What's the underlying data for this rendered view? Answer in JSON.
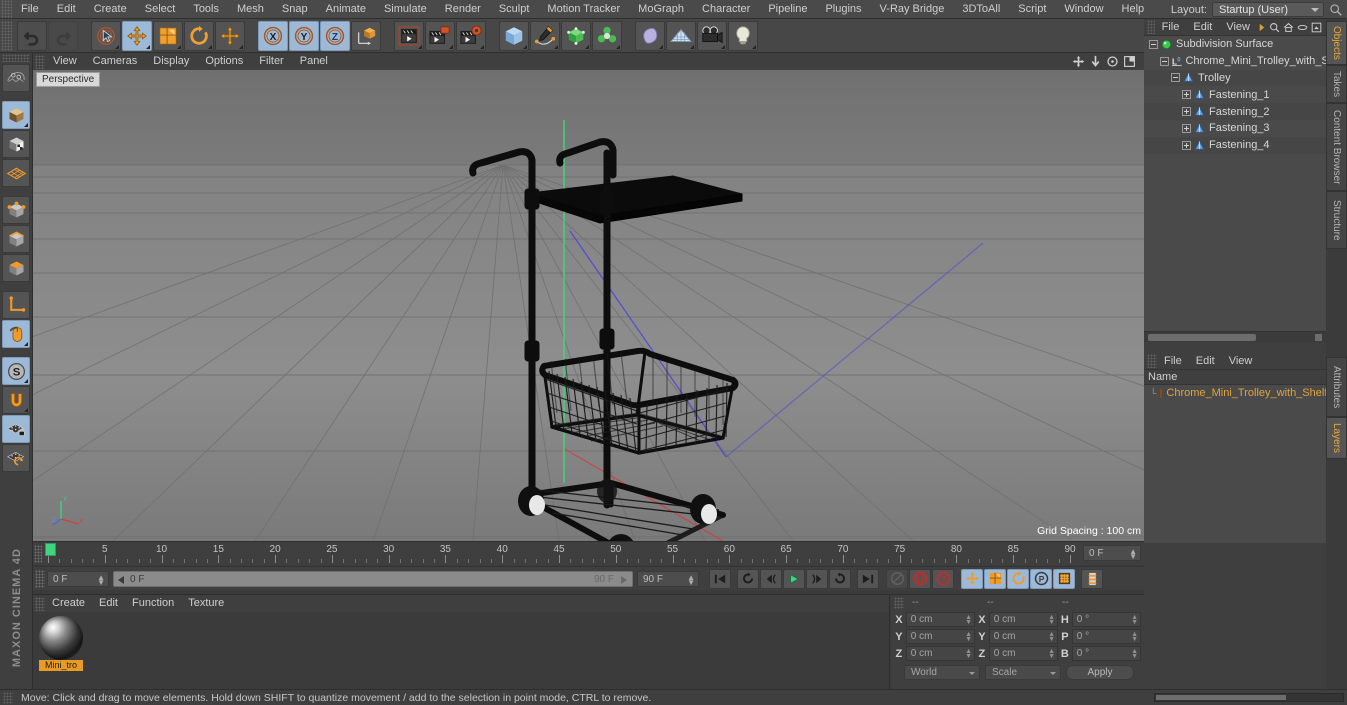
{
  "app": {
    "title": "Cinema 4D",
    "brand": "MAXON CINEMA 4D"
  },
  "menubar": {
    "items": [
      {
        "label": "File"
      },
      {
        "label": "Edit"
      },
      {
        "label": "Create"
      },
      {
        "label": "Select"
      },
      {
        "label": "Tools"
      },
      {
        "label": "Mesh"
      },
      {
        "label": "Snap"
      },
      {
        "label": "Animate"
      },
      {
        "label": "Simulate"
      },
      {
        "label": "Render"
      },
      {
        "label": "Sculpt"
      },
      {
        "label": "Motion Tracker"
      },
      {
        "label": "MoGraph"
      },
      {
        "label": "Character"
      },
      {
        "label": "Pipeline"
      },
      {
        "label": "Plugins"
      },
      {
        "label": "V-Ray Bridge"
      },
      {
        "label": "3DToAll"
      },
      {
        "label": "Script"
      },
      {
        "label": "Window"
      },
      {
        "label": "Help"
      }
    ],
    "layout_label": "Layout:",
    "layout_value": "Startup (User)",
    "search_icon": "search-icon"
  },
  "toolbar": {
    "buttons": [
      {
        "name": "undo-button",
        "icon": "undo-arrow-icon",
        "state": "enabled"
      },
      {
        "name": "redo-button",
        "icon": "redo-arrow-icon",
        "state": "disabled"
      },
      {
        "name": "live-selection-tool",
        "icon": "cursor-circle-icon",
        "state": "normal"
      },
      {
        "name": "move-tool",
        "icon": "move-arrows-icon",
        "state": "active"
      },
      {
        "name": "scale-tool",
        "icon": "scale-box-icon",
        "state": "normal"
      },
      {
        "name": "rotate-tool",
        "icon": "rotate-ring-icon",
        "state": "normal"
      },
      {
        "name": "move-axis-tool",
        "icon": "plus-arrows-icon",
        "state": "normal"
      },
      {
        "name": "x-axis-lock",
        "icon": "x-axis-icon",
        "state": "active"
      },
      {
        "name": "y-axis-lock",
        "icon": "y-axis-icon",
        "state": "active"
      },
      {
        "name": "z-axis-lock",
        "icon": "z-axis-icon",
        "state": "active"
      },
      {
        "name": "world-object-coordinates",
        "icon": "world-axis-cube-icon",
        "state": "normal"
      },
      {
        "name": "render-view",
        "icon": "render-clapper-icon",
        "state": "normal"
      },
      {
        "name": "render-region",
        "icon": "render-region-icon",
        "state": "normal"
      },
      {
        "name": "render-settings",
        "icon": "render-settings-icon",
        "state": "normal"
      },
      {
        "name": "add-cube-object",
        "icon": "cube-icon",
        "state": "normal"
      },
      {
        "name": "spline-pen",
        "icon": "pen-spline-icon",
        "state": "normal"
      },
      {
        "name": "generators",
        "icon": "green-cube-icon",
        "state": "normal"
      },
      {
        "name": "deformers",
        "icon": "green-atom-icon",
        "state": "normal"
      },
      {
        "name": "scene-environment",
        "icon": "environment-blob-icon",
        "state": "normal"
      },
      {
        "name": "scene-floor",
        "icon": "floor-grid-icon",
        "state": "normal"
      },
      {
        "name": "camera-object",
        "icon": "camera-icon",
        "state": "normal"
      },
      {
        "name": "light-object",
        "icon": "lightbulb-icon",
        "state": "normal"
      }
    ]
  },
  "left_toolbar": {
    "buttons": [
      {
        "name": "make-editable",
        "icon": "make-editable-icon",
        "state": "normal"
      },
      {
        "name": "model-mode",
        "icon": "model-cube-icon",
        "state": "active"
      },
      {
        "name": "texture-mode",
        "icon": "texture-cube-icon",
        "state": "normal"
      },
      {
        "name": "workplane-mode",
        "icon": "workplane-grid-icon",
        "state": "normal"
      },
      {
        "name": "point-mode",
        "icon": "point-cube-icon",
        "state": "normal"
      },
      {
        "name": "edge-mode",
        "icon": "edge-cube-icon",
        "state": "normal"
      },
      {
        "name": "polygon-mode",
        "icon": "polygon-cube-icon",
        "state": "normal"
      },
      {
        "name": "enable-axis-modification",
        "icon": "axis-l-icon",
        "state": "normal"
      },
      {
        "name": "viewport-solo",
        "icon": "mouse-icon",
        "state": "active"
      },
      {
        "name": "soft-selection",
        "icon": "s-circle-icon",
        "state": "active"
      },
      {
        "name": "snap-enable",
        "icon": "magnet-icon",
        "state": "normal"
      },
      {
        "name": "workplane-lock",
        "icon": "grid-lock-icon",
        "state": "active"
      },
      {
        "name": "workplane-reset",
        "icon": "grid-reset-icon",
        "state": "normal"
      }
    ]
  },
  "viewport": {
    "menu": [
      {
        "label": "View"
      },
      {
        "label": "Cameras"
      },
      {
        "label": "Display"
      },
      {
        "label": "Options"
      },
      {
        "label": "Filter"
      },
      {
        "label": "Panel"
      }
    ],
    "view_name": "Perspective",
    "grid_spacing": "Grid Spacing : 100 cm",
    "icons": [
      {
        "name": "pan-view-icon"
      },
      {
        "name": "dolly-view-icon"
      },
      {
        "name": "rotate-view-icon"
      },
      {
        "name": "maximize-view-icon"
      }
    ],
    "axis_labels": {
      "y": "Y",
      "x": "X",
      "z": "Z"
    },
    "scene_object": "Chrome Mini Trolley with Shelf"
  },
  "object_manager": {
    "menu": [
      {
        "label": "File"
      },
      {
        "label": "Edit"
      },
      {
        "label": "View"
      }
    ],
    "head_icons": [
      "chevron-right-icon",
      "search-icon",
      "home-icon",
      "ellipse-icon",
      "fit-icon"
    ],
    "tree": [
      {
        "label": "Subdivision Surface",
        "depth": 0,
        "icon": "subdivision-surface-icon",
        "expander": "minus",
        "alt": false
      },
      {
        "label": "Chrome_Mini_Trolley_with_Shelf",
        "depth": 1,
        "icon": "layer-icon",
        "expander": "minus",
        "alt": false
      },
      {
        "label": "Trolley",
        "depth": 2,
        "icon": "null-object-icon",
        "expander": "minus",
        "alt": true
      },
      {
        "label": "Fastening_1",
        "depth": 3,
        "icon": "null-object-icon",
        "expander": "plus",
        "alt": false
      },
      {
        "label": "Fastening_2",
        "depth": 3,
        "icon": "null-object-icon",
        "expander": "plus",
        "alt": true
      },
      {
        "label": "Fastening_3",
        "depth": 3,
        "icon": "null-object-icon",
        "expander": "plus",
        "alt": false
      },
      {
        "label": "Fastening_4",
        "depth": 3,
        "icon": "null-object-icon",
        "expander": "plus",
        "alt": true
      }
    ]
  },
  "layer_manager": {
    "menu": [
      {
        "label": "File"
      },
      {
        "label": "Edit"
      },
      {
        "label": "View"
      }
    ],
    "column_header": "Name",
    "rows": [
      {
        "label": "Chrome_Mini_Trolley_with_Shelf_",
        "color": "#e07b2a"
      }
    ]
  },
  "panel_tabs_top": [
    {
      "label": "Objects",
      "selected": true
    },
    {
      "label": "Takes",
      "selected": false
    },
    {
      "label": "Content Browser",
      "selected": false
    },
    {
      "label": "Structure",
      "selected": false
    }
  ],
  "panel_tabs_bottom": [
    {
      "label": "Attributes",
      "selected": false
    },
    {
      "label": "Layers",
      "selected": true
    }
  ],
  "timeline": {
    "ticks": [
      0,
      5,
      10,
      15,
      20,
      25,
      30,
      35,
      40,
      45,
      50,
      55,
      60,
      65,
      70,
      75,
      80,
      85,
      90
    ],
    "min": 0,
    "max": 90,
    "current_frame_label": "0 F",
    "playhead_frame": 0
  },
  "transport": {
    "current_frame_field": "0 F",
    "range_start_label": "0 F",
    "range_end_label": "90 F",
    "end_frame_field": "90 F",
    "buttons": [
      {
        "name": "go-to-start-button",
        "icon": "skip-start-icon",
        "state": "normal"
      },
      {
        "name": "play-backwards-button",
        "icon": "loop-back-icon",
        "state": "normal"
      },
      {
        "name": "previous-frame-button",
        "icon": "step-back-icon",
        "state": "normal"
      },
      {
        "name": "play-button",
        "icon": "play-icon",
        "state": "normal"
      },
      {
        "name": "next-frame-button",
        "icon": "step-forward-icon",
        "state": "normal"
      },
      {
        "name": "play-forward-loop-button",
        "icon": "loop-forward-icon",
        "state": "normal"
      },
      {
        "name": "go-to-end-button",
        "icon": "skip-end-icon",
        "state": "normal"
      },
      {
        "name": "record-active-objects-button",
        "icon": "record-disabled-icon",
        "state": "disabled"
      },
      {
        "name": "autokeying-button",
        "icon": "red-parens-icon",
        "state": "normal"
      },
      {
        "name": "keyframe-selection-button",
        "icon": "red-question-icon",
        "state": "normal"
      },
      {
        "name": "position-key-button",
        "icon": "position-arrows-icon",
        "state": "active"
      },
      {
        "name": "scale-key-button",
        "icon": "scale-key-icon",
        "state": "active"
      },
      {
        "name": "rotation-key-button",
        "icon": "rotation-key-icon",
        "state": "active"
      },
      {
        "name": "parameter-key-button",
        "icon": "p-circle-icon",
        "state": "active"
      },
      {
        "name": "point-level-animation-button",
        "icon": "pla-dots-icon",
        "state": "active"
      },
      {
        "name": "timeline-toggle-button",
        "icon": "timeline-strip-icon",
        "state": "normal"
      }
    ]
  },
  "material_manager": {
    "menu": [
      {
        "label": "Create"
      },
      {
        "label": "Edit"
      },
      {
        "label": "Function"
      },
      {
        "label": "Texture"
      }
    ],
    "materials": [
      {
        "name": "Mini_tro",
        "selected": true,
        "preview": "chrome-sphere"
      }
    ]
  },
  "coordinates": {
    "headers": [
      "--",
      "--",
      "--"
    ],
    "rows": [
      {
        "axis1": "X",
        "pos": "0 cm",
        "axis2": "X",
        "size": "0 cm",
        "axis3": "H",
        "rot": "0 °"
      },
      {
        "axis1": "Y",
        "pos": "0 cm",
        "axis2": "Y",
        "size": "0 cm",
        "axis3": "P",
        "rot": "0 °"
      },
      {
        "axis1": "Z",
        "pos": "0 cm",
        "axis2": "Z",
        "size": "0 cm",
        "axis3": "B",
        "rot": "0 °"
      }
    ],
    "coord_system": "World",
    "size_mode": "Scale",
    "apply_label": "Apply"
  },
  "statusbar": {
    "message": "Move: Click and drag to move elements. Hold down SHIFT to quantize movement / add to the selection in point mode, CTRL to remove."
  },
  "colors": {
    "accent_orange": "#e89a23",
    "selection_blue": "#9db9d8",
    "panel_bg": "#3f3f3f",
    "viewport_bg": "#7d7d7d",
    "green_axis": "#3fd57f"
  }
}
